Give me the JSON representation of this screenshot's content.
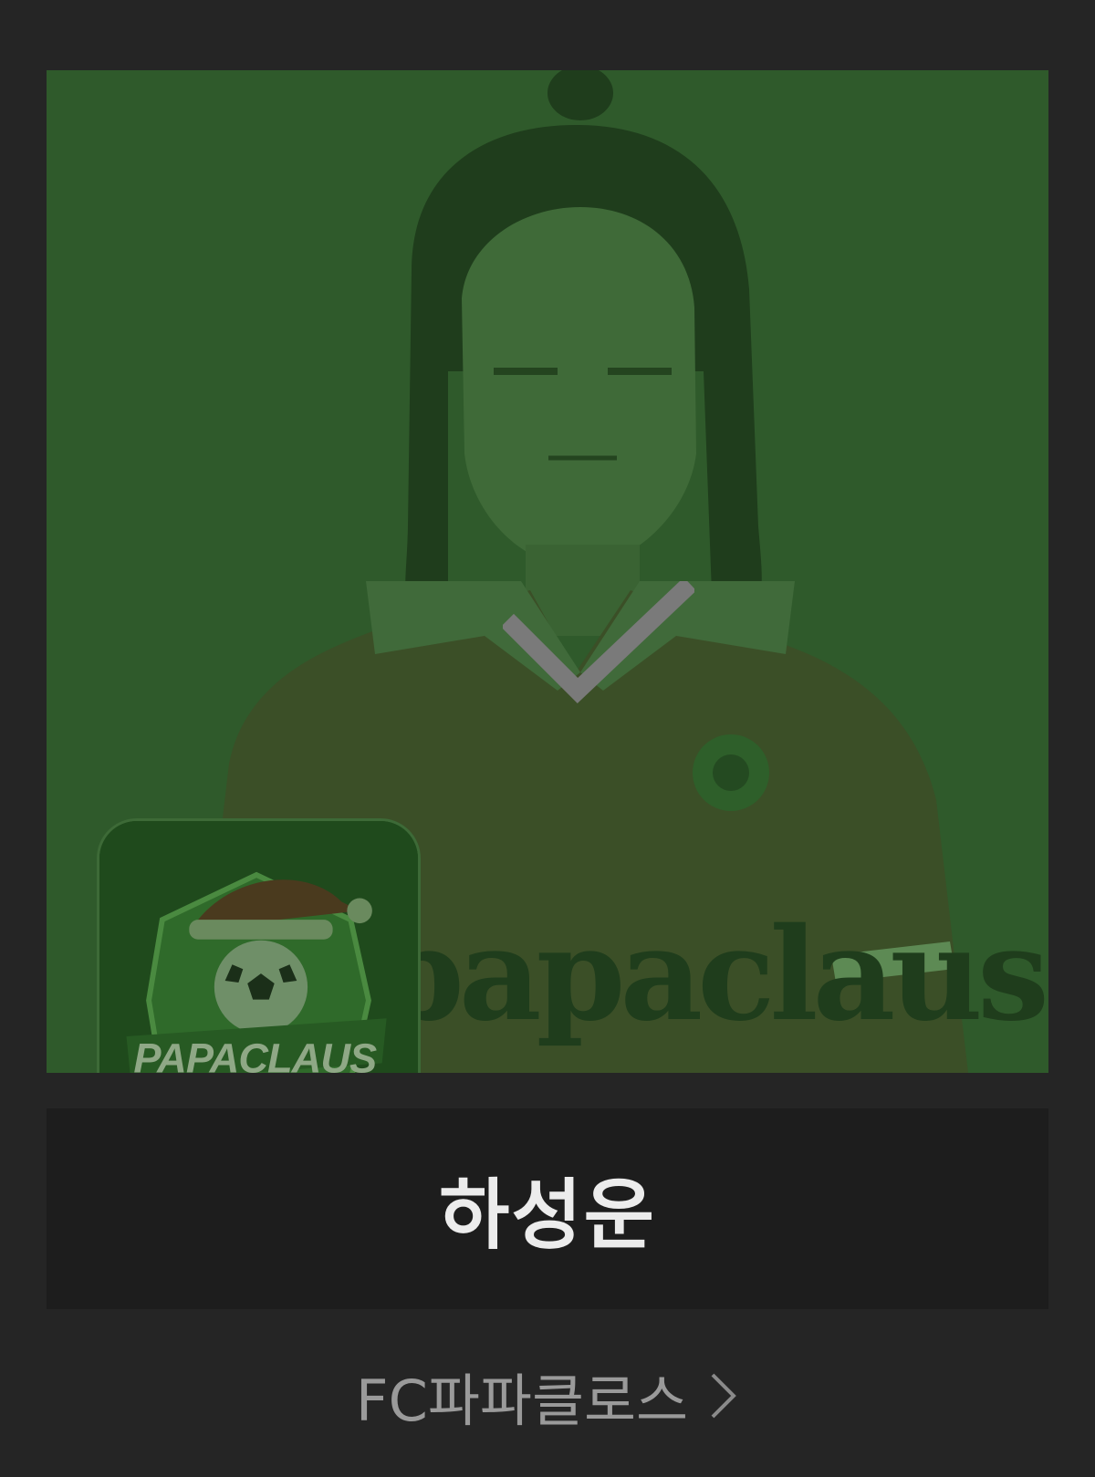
{
  "player": {
    "name": "하성운",
    "status_icon": "check-icon",
    "selected": true
  },
  "team": {
    "name": "FC파파클로스",
    "logo_text": "PAPACLAUS",
    "jersey_text": "papaclaus",
    "link_icon": "chevron-right-icon"
  },
  "colors": {
    "background": "#252525",
    "photo_tint": "#2f5a2b",
    "name_bar": "#1d1d1d",
    "name_text": "#ececec",
    "team_text": "#9a9a9a"
  }
}
